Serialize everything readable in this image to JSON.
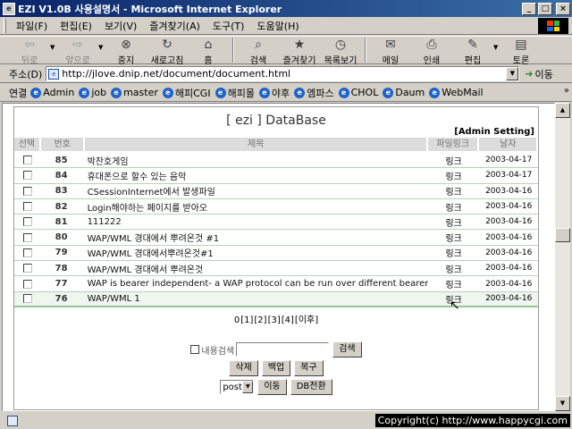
{
  "window": {
    "title": "EZI V1.0B 사용설명서 - Microsoft Internet Explorer",
    "minimize": "_",
    "maximize": "□",
    "close": "×"
  },
  "menu": {
    "items": [
      "파일(F)",
      "편집(E)",
      "보기(V)",
      "즐겨찾기(A)",
      "도구(T)",
      "도움말(H)"
    ]
  },
  "toolbar": {
    "back": "뒤로",
    "forward": "앞으로",
    "stop": "중지",
    "refresh": "새로고침",
    "home": "홈",
    "search": "검색",
    "favorites": "즐겨찾기",
    "history": "목록보기",
    "mail": "메일",
    "print": "인쇄",
    "edit": "편집",
    "discuss": "토론"
  },
  "address": {
    "label": "주소(D)",
    "url": "http://jlove.dnip.net/document/document.html",
    "go": "이동"
  },
  "links": {
    "label": "연결",
    "items": [
      "Admin",
      "job",
      "master",
      "해피CGI",
      "해피몰",
      "야후",
      "엠파스",
      "CHOL",
      "Daum",
      "WebMail"
    ],
    "more": "»"
  },
  "board": {
    "title": "[ ezi ] DataBase",
    "admin_setting": "[Admin Setting]",
    "columns": {
      "select": "선택",
      "number": "번호",
      "subject": "제목",
      "file_link": "파일링크",
      "date": "날자"
    },
    "rows": [
      {
        "num": "85",
        "subject": "박찬호게임",
        "link": "링크",
        "date": "2003-04-17"
      },
      {
        "num": "84",
        "subject": "휴대폰으로 할수 있는 음악",
        "link": "링크",
        "date": "2003-04-17"
      },
      {
        "num": "83",
        "subject": "CSessionInternet에서 발생파일",
        "link": "링크",
        "date": "2003-04-16"
      },
      {
        "num": "82",
        "subject": "Login해야하는 페이지를 받아오",
        "link": "링크",
        "date": "2003-04-16"
      },
      {
        "num": "81",
        "subject": "111222",
        "link": "링크",
        "date": "2003-04-16"
      },
      {
        "num": "80",
        "subject": "WAP/WML 경대에서 뿌려온것 #1",
        "link": "링크",
        "date": "2003-04-16"
      },
      {
        "num": "79",
        "subject": "WAP/WML 경대에서뿌려온것#1",
        "link": "링크",
        "date": "2003-04-16"
      },
      {
        "num": "78",
        "subject": "WAP/WML 경대에서 뿌려온것",
        "link": "링크",
        "date": "2003-04-16"
      },
      {
        "num": "77",
        "subject": "WAP is bearer independent- a WAP protocol can be run over different bearers, So",
        "link": "링크",
        "date": "2003-04-16"
      },
      {
        "num": "76",
        "subject": "WAP/WML 1",
        "link": "링크",
        "date": "2003-04-16"
      }
    ],
    "pager": [
      "0",
      "[1]",
      "[2]",
      "[3]",
      "[4]",
      "[이후]"
    ],
    "search_label": "내용검색",
    "search_button": "검색",
    "delete_button": "삭제",
    "backup_button": "백업",
    "restore_button": "복구",
    "select_value": "post",
    "move_button": "이동",
    "db_switch_button": "DB전환"
  },
  "status": {
    "text": "",
    "copyright": "Copyright(c) http://www.happycgi.com"
  }
}
